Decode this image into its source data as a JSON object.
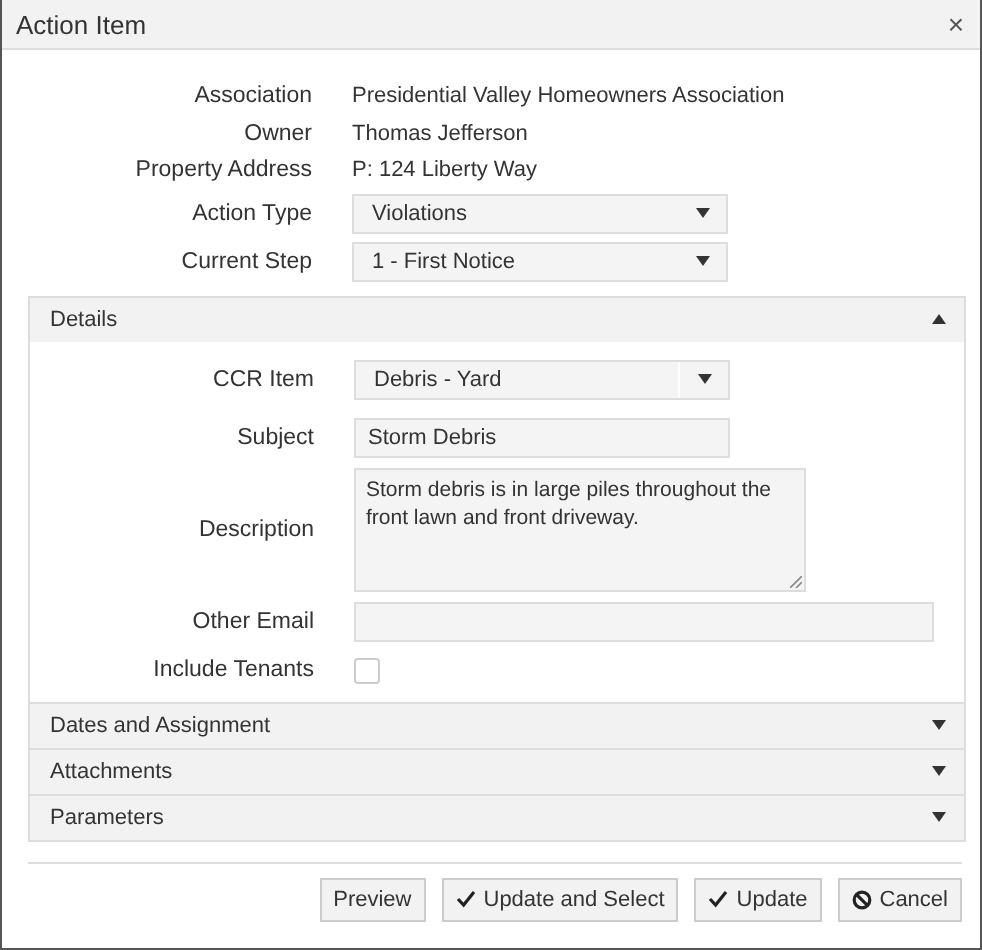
{
  "dialog": {
    "title": "Action Item",
    "close": "×"
  },
  "fields": [
    {
      "kind": "text",
      "label": "Association",
      "value": "Presidential Valley Homeowners Association"
    },
    {
      "kind": "text",
      "label": "Owner",
      "value": "Thomas Jefferson"
    },
    {
      "kind": "text",
      "label": "Property Address",
      "value": "P: 124 Liberty Way"
    },
    {
      "kind": "select",
      "label": "Action Type",
      "value": "Violations"
    },
    {
      "kind": "select",
      "label": "Current Step",
      "value": "1 - First Notice"
    }
  ],
  "sections": [
    {
      "title": "Details",
      "expanded": true,
      "fields": [
        {
          "kind": "combo",
          "label": "CCR Item",
          "value": "Debris - Yard"
        },
        {
          "kind": "input",
          "label": "Subject",
          "value": "Storm Debris"
        },
        {
          "kind": "textarea",
          "label": "Description",
          "value": "Storm debris is in large piles throughout the front lawn and front driveway."
        },
        {
          "kind": "wide",
          "label": "Other Email"
        },
        {
          "kind": "checkbox",
          "label": "Include Tenants",
          "checked": false
        }
      ]
    },
    {
      "title": "Dates and Assignment",
      "expanded": false
    },
    {
      "title": "Attachments",
      "expanded": false
    },
    {
      "title": "Parameters",
      "expanded": false
    }
  ],
  "buttons": [
    {
      "label": "Preview",
      "kind": "plain"
    },
    {
      "label": "Update and Select",
      "kind": "confirm"
    },
    {
      "label": "Update",
      "kind": "confirm"
    },
    {
      "label": "Cancel",
      "kind": "cancel"
    }
  ]
}
